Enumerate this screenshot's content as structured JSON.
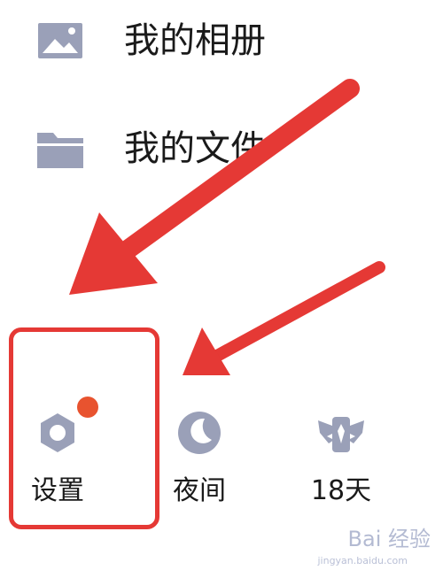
{
  "menu": {
    "items": [
      {
        "label": "我的相册",
        "icon": "image-icon"
      },
      {
        "label": "我的文件",
        "icon": "folder-icon"
      }
    ]
  },
  "bottom_bar": {
    "buttons": [
      {
        "label": "设置",
        "icon": "gear-icon",
        "badge": true
      },
      {
        "label": "夜间",
        "icon": "moon-icon"
      },
      {
        "label": "18天",
        "icon": "winged-badge-icon"
      }
    ]
  },
  "watermark": {
    "text": "Bai 经验",
    "sub": "jingyan.baidu.com"
  },
  "colors": {
    "icon": "#9aa0b8",
    "annotation_red": "#e53935",
    "badge": "#e8532f"
  }
}
